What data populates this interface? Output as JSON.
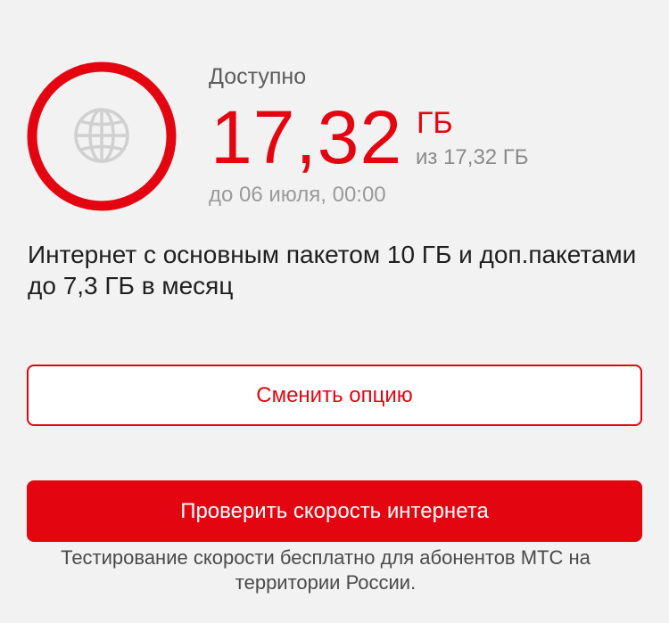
{
  "usage": {
    "status_label": "Доступно",
    "amount": "17,32",
    "unit": "ГБ",
    "total": "из 17,32 ГБ",
    "expires": "до 06 июля, 00:00",
    "remaining_fraction": 1.0,
    "icon": "globe-icon"
  },
  "description": "Интернет с основным пакетом 10 ГБ и доп.пакетами до 7,3 ГБ в месяц",
  "buttons": {
    "change_option": "Сменить опцию",
    "check_speed": "Проверить скорость интернета"
  },
  "note": "Тестирование скорости бесплатно для абонентов МТС на территории России.",
  "colors": {
    "accent": "#e30611",
    "background": "#f2f2f2",
    "icon_gray": "#d0d0d0"
  }
}
